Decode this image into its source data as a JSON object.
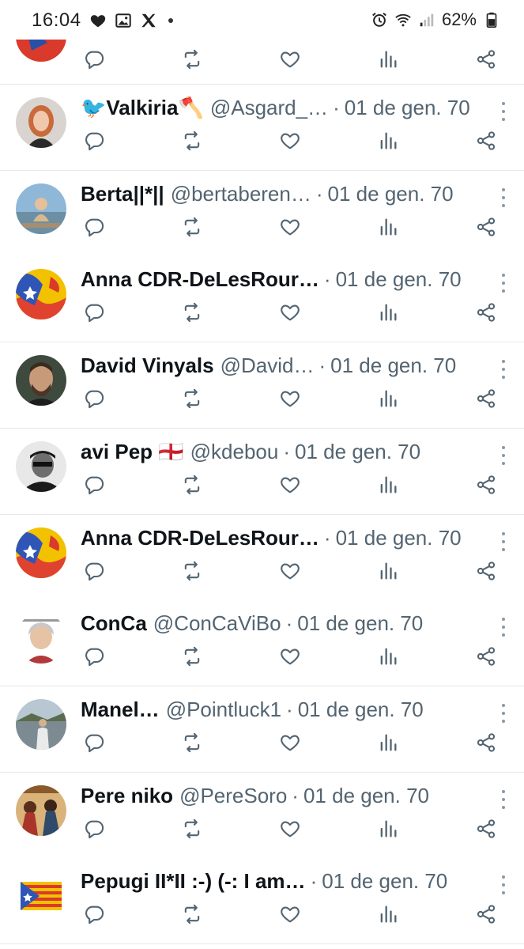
{
  "status_bar": {
    "time": "16:04",
    "battery": "62%",
    "left_icons": [
      "heart-icon",
      "image-icon",
      "x-logo-icon"
    ],
    "right_icons": [
      "alarm-icon",
      "wifi-icon",
      "signal-icon",
      "battery-icon"
    ]
  },
  "colors": {
    "text_primary": "#0f1419",
    "text_secondary": "#536471",
    "icon": "#536471",
    "divider": "#e6e8ea"
  },
  "tweets": [
    {
      "name": "🐦Valkiria🪓",
      "handle": "@Asgard_…",
      "date": "01 de gen. 70",
      "avatar": "woman-red-hair"
    },
    {
      "name": "Berta||*||",
      "handle": "@bertaberen…",
      "date": "01 de gen. 70",
      "avatar": "woman-lake"
    },
    {
      "name": "Anna CDR-DeLesRour…",
      "handle": "",
      "date": "01 de gen. 70",
      "avatar": "estelada-splash"
    },
    {
      "name": "David Vinyals",
      "handle": "@David…",
      "date": "01 de gen. 70",
      "avatar": "man-beard"
    },
    {
      "name": "avi Pep 🏴󠁧󠁢󠁥󠁮󠁧󠁿",
      "handle": "@kdebou",
      "date": "01 de gen. 70",
      "avatar": "man-bw"
    },
    {
      "name": "Anna CDR-DeLesRour…",
      "handle": "",
      "date": "01 de gen. 70",
      "avatar": "estelada-splash"
    },
    {
      "name": "ConCa",
      "handle": "@ConCaViBo",
      "date": "01 de gen. 70",
      "avatar": "older-woman"
    },
    {
      "name": "Manel…",
      "handle": "@Pointluck1",
      "date": "01 de gen. 70",
      "avatar": "man-lake"
    },
    {
      "name": "Pere niko",
      "handle": "@PereSoro",
      "date": "01 de gen. 70",
      "avatar": "painting"
    },
    {
      "name": "Pepugi II*II :-) (-: I am…",
      "handle": "",
      "date": "01 de gen. 70",
      "avatar": "estelada-flag"
    }
  ],
  "actions": [
    "reply-icon",
    "retweet-icon",
    "like-icon",
    "views-icon",
    "share-icon"
  ]
}
